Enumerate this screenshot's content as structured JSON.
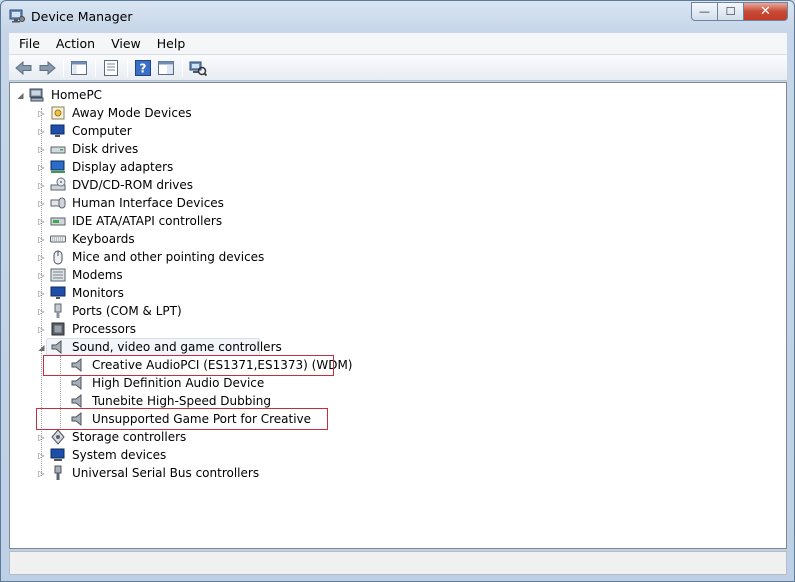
{
  "window": {
    "title": "Device Manager",
    "minimize_glyph": "—",
    "maximize_glyph": "☐",
    "close_glyph": "✕"
  },
  "menu": [
    {
      "label": "File"
    },
    {
      "label": "Action"
    },
    {
      "label": "View"
    },
    {
      "label": "Help"
    }
  ],
  "toolbar": {
    "buttons": [
      "back-arrow-icon",
      "forward-arrow-icon",
      "show-hide-console-tree-icon",
      "properties-icon",
      "help-icon",
      "update-driver-icon",
      "scan-hardware-icon"
    ]
  },
  "tree": {
    "root": "HomePC",
    "categories": [
      {
        "label": "Away Mode Devices",
        "icon": "away-mode-icon"
      },
      {
        "label": "Computer",
        "icon": "computer-icon"
      },
      {
        "label": "Disk drives",
        "icon": "disk-drive-icon"
      },
      {
        "label": "Display adapters",
        "icon": "display-adapter-icon"
      },
      {
        "label": "DVD/CD-ROM drives",
        "icon": "dvd-drive-icon"
      },
      {
        "label": "Human Interface Devices",
        "icon": "hid-icon"
      },
      {
        "label": "IDE ATA/ATAPI controllers",
        "icon": "ide-controller-icon"
      },
      {
        "label": "Keyboards",
        "icon": "keyboard-icon"
      },
      {
        "label": "Mice and other pointing devices",
        "icon": "mouse-icon"
      },
      {
        "label": "Modems",
        "icon": "modem-icon"
      },
      {
        "label": "Monitors",
        "icon": "monitor-icon"
      },
      {
        "label": "Ports (COM & LPT)",
        "icon": "port-icon"
      },
      {
        "label": "Processors",
        "icon": "processor-icon"
      },
      {
        "label": "Sound, video and game controllers",
        "icon": "speaker-icon",
        "expanded": true,
        "children": [
          {
            "label": "Creative AudioPCI (ES1371,ES1373) (WDM)",
            "icon": "speaker-icon",
            "highlighted": true
          },
          {
            "label": "High Definition Audio Device",
            "icon": "speaker-icon"
          },
          {
            "label": "Tunebite High-Speed Dubbing",
            "icon": "speaker-icon"
          },
          {
            "label": "Unsupported Game Port for Creative",
            "icon": "speaker-icon",
            "highlighted": true
          }
        ]
      },
      {
        "label": "Storage controllers",
        "icon": "storage-controller-icon"
      },
      {
        "label": "System devices",
        "icon": "system-devices-icon"
      },
      {
        "label": "Universal Serial Bus controllers",
        "icon": "usb-icon"
      }
    ]
  },
  "colors": {
    "highlight_border": "#c0313c",
    "title_gradient_top": "#d9e5f2",
    "close_button": "#c74a35"
  }
}
